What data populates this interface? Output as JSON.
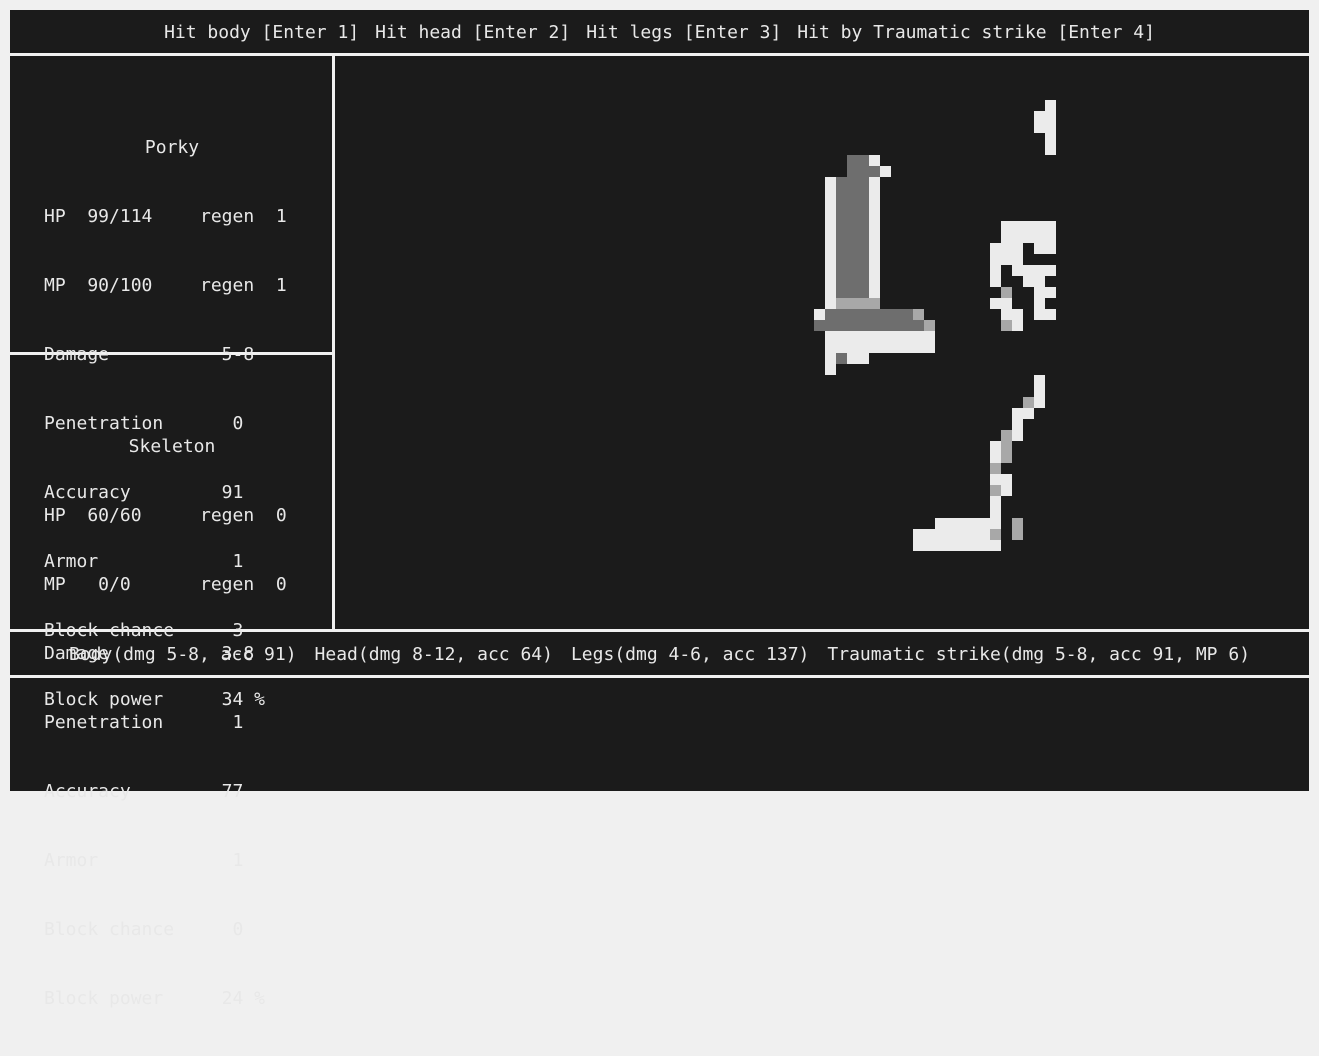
{
  "actions": [
    {
      "label": "Hit body [Enter 1]"
    },
    {
      "label": "Hit head [Enter 2]"
    },
    {
      "label": "Hit legs [Enter 3]"
    },
    {
      "label": "Hit by Traumatic strike [Enter 4]"
    }
  ],
  "player": {
    "name": "Porky",
    "hp": "HP  99/114",
    "hp_regen": "regen  1",
    "mp": "MP  90/100",
    "mp_regen": "regen  1",
    "damage_label": "Damage",
    "damage": "  5-8",
    "penetration_label": "Penetration",
    "penetration": "   0",
    "accuracy_label": "Accuracy",
    "accuracy": "  91",
    "armor_label": "Armor",
    "armor": "   1",
    "block_chance_label": "Block chance",
    "block_chance": "   3",
    "block_power_label": "Block power",
    "block_power": "  34 %"
  },
  "enemy": {
    "name": "Skeleton",
    "hp": "HP  60/60",
    "hp_regen": "regen  0",
    "mp": "MP   0/0",
    "mp_regen": "regen  0",
    "damage_label": "Damage",
    "damage": "  3-8",
    "penetration_label": "Penetration",
    "penetration": "   1",
    "accuracy_label": "Accuracy",
    "accuracy": "  77",
    "armor_label": "Armor",
    "armor": "   1",
    "block_chance_label": "Block chance",
    "block_chance": "   0",
    "block_power_label": "Block power",
    "block_power": "  24 %"
  },
  "attack_info": [
    {
      "text": "Body(dmg 5-8, acc 91)"
    },
    {
      "text": "Head(dmg 8-12, acc 64)"
    },
    {
      "text": "Legs(dmg 4-6, acc 137)"
    },
    {
      "text": "Traumatic strike(dmg 5-8, acc 91, MP 6)"
    }
  ],
  "colors": {
    "background": "#1b1b1b",
    "border": "#f0f0f0",
    "text": "#e8e8e8",
    "bone_light": "#ebebeb",
    "bone_mid": "#a8a8a8",
    "bone_dark": "#6e6e6e"
  },
  "sprite": {
    "name": "skeleton-with-sword",
    "pixels": [
      "...............................wwwwwww..........",
      "..............................wwwwwwwwlll.......",
      "..............................wwwwwwwwwwl.......",
      "...............................wdwdwwwwwl.......",
      "...............................wdwdwwwwwl.......",
      ".............ddw................wwwwwwwl........",
      ".............dddw................wwwwwl.........",
      "...........wdddw.................w.w.w.........",
      "...........wdddw.................wwwwww.........",
      "...........wdddw.................w.ll...........",
      "...........wdddw..................wl............",
      "...........wdddw...........wwwwww.wwwww.........",
      "...........wdddw...........wwwwwwwwwwwwlw.......",
      "...........wdddw..........www.wwwwwwwwwwwlww....",
      "...........wdddw..........www......wwwwwlw.ww...",
      "...........wdddw..........w.wwwwwwwwwwwwww..ww..",
      "...........wdddw..........w..ww...wwwwwww....ww.",
      "...........wdddw...........l..wwwwwwwwwwl....wl.",
      "...........wllll..........ww..w..ww...ll.....ww.",
      "..........wddddddddl.......ww.wwwwwwwwww.....ww.",
      "..........ddddddddddl......lw.....ww.........ww.",
      "...........wwwwwwwwww.............ww........ww..",
      "...........wwwwwwwwww...........wwwwww...wwww...",
      "...........wdww.................wlwwwlw..wllw...",
      "...........w....................wwwwwwl..www....",
      "..............................w.lw.lww..........",
      "..............................w.www..lw.........",
      ".............................lw.wwwwwww.........",
      "............................ww........ww........",
      "............................w.........lw........",
      "...........................lw..........w........",
      "..........................wl...........lw.......",
      "..........................wl............ww......",
      "..........................l.............lw......",
      "..........................ww............ww......",
      "..........................lw.............w......",
      "..........................w..............lw.....",
      "..........................w..............lw.....",
      ".....................wwwwww.l...........wwwwl...",
      "...................wwwwwwwl.l.........wwwwwww...",
      "...................wwwwwwww...........wwwwwwl..."
    ]
  }
}
